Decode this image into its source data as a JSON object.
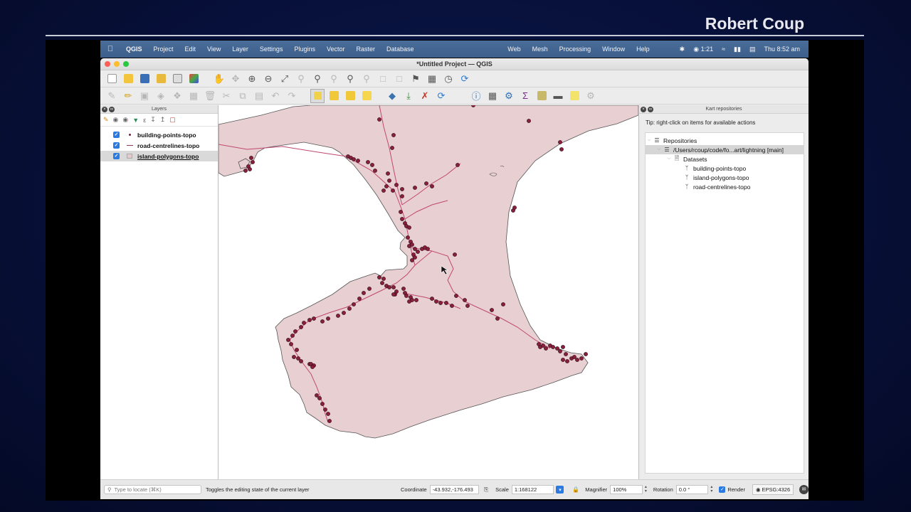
{
  "presenter_name": "Robert Coup",
  "menubar": {
    "app_name": "QGIS",
    "left_menus": [
      "Project",
      "Edit",
      "View",
      "Layer",
      "Settings",
      "Plugins",
      "Vector",
      "Raster",
      "Database"
    ],
    "right_menus": [
      "Web",
      "Mesh",
      "Processing",
      "Window",
      "Help"
    ],
    "recording_time": "1:21",
    "clock": "Thu  8:52 am"
  },
  "window": {
    "title": "*Untitled Project — QGIS"
  },
  "layers_panel": {
    "title": "Layers",
    "layers": [
      {
        "name": "building-points-topo",
        "checked": true,
        "symbol": "point"
      },
      {
        "name": "road-centrelines-topo",
        "checked": true,
        "symbol": "line"
      },
      {
        "name": "island-polygons-topo",
        "checked": true,
        "symbol": "polygon"
      }
    ]
  },
  "kart_panel": {
    "title": "Kart repositories",
    "tip": "Tip: right-click on items for available actions",
    "tree": {
      "root_label": "Repositories",
      "repo_label": "/Users/rcoup/code/fo...art/lightning [main]",
      "datasets_label": "Datasets",
      "datasets": [
        "building-points-topo",
        "island-polygons-topo",
        "road-centrelines-topo"
      ]
    }
  },
  "map": {
    "land_color": "#e8cfd2",
    "coast_color": "#555555",
    "road_color": "#c04870",
    "point_color": "#8a1f3c",
    "point_outline": "#2a0a14"
  },
  "statusbar": {
    "locator_placeholder": "Type to locate (⌘K)",
    "message": "Toggles the editing state of the current layer",
    "coordinate_label": "Coordinate",
    "coordinate_value": "-43.932,-176.493",
    "scale_label": "Scale",
    "scale_value": "1:168122",
    "magnifier_label": "Magnifier",
    "magnifier_value": "100%",
    "rotation_label": "Rotation",
    "rotation_value": "0.0 °",
    "render_label": "Render",
    "crs_label": "EPSG:4326"
  }
}
